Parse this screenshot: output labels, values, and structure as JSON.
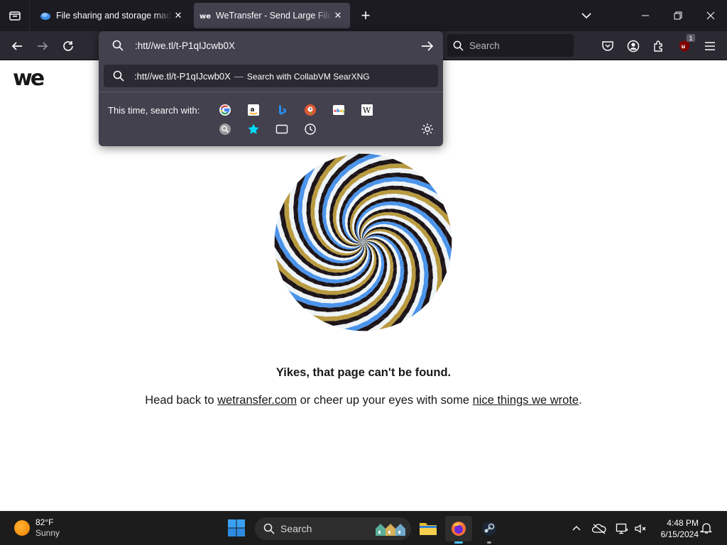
{
  "browser": {
    "tabs": [
      {
        "title": "File sharing and storage made simple",
        "active": false
      },
      {
        "title": "WeTransfer - Send Large Files & Share Photos Online",
        "active": true
      }
    ],
    "new_tab_label": "+",
    "url_text": ":htt//we.tl/t-P1qIJcwb0X",
    "search_placeholder": "Search",
    "extension_badge": "1"
  },
  "url_dropdown": {
    "suggestion_text": ":htt//we.tl/t-P1qIJcwb0X",
    "suggestion_dash": "—",
    "suggestion_action": "Search with CollabVM SearXNG",
    "this_time_label": "This time, search with:",
    "engines": [
      "google-icon",
      "amazon-icon",
      "bing-icon",
      "duckduckgo-icon",
      "ebay-icon",
      "wikipedia-icon",
      "searxng-icon",
      "bookmarks-icon",
      "tabs-icon",
      "history-icon"
    ]
  },
  "page": {
    "logo_text": "we",
    "heading": "Yikes, that page can't be found.",
    "line_prefix": "Head back to ",
    "link1": "wetransfer.com",
    "line_middle": " or cheer up your eyes with some ",
    "link2": "nice things we wrote",
    "line_suffix": "."
  },
  "taskbar": {
    "temperature": "82°F",
    "condition": "Sunny",
    "search_label": "Search",
    "time": "4:48 PM",
    "date": "6/15/2024"
  },
  "colors": {
    "spiral_gold": "#b8993e",
    "spiral_blue": "#4a93ea",
    "spiral_dark": "#1c1418",
    "spiral_light": "#eef3f6"
  }
}
